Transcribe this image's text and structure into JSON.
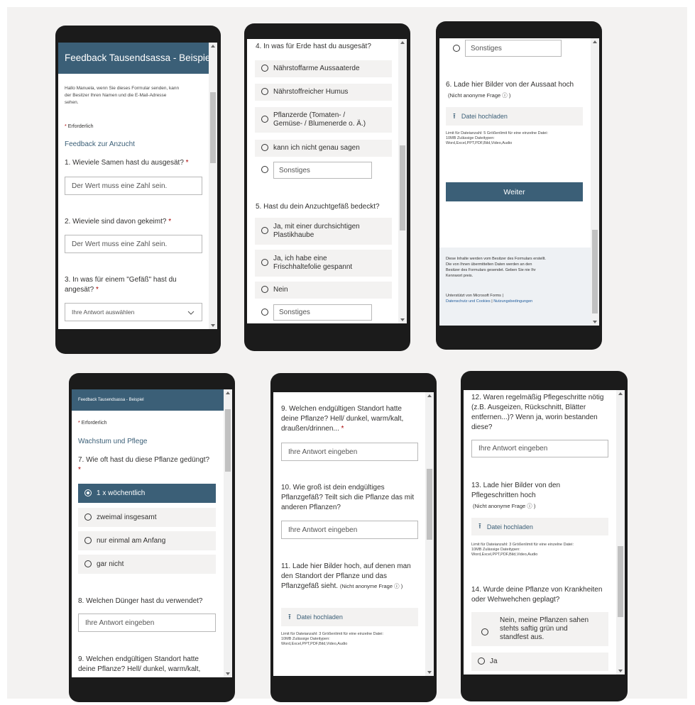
{
  "p1": {
    "title": "Feedback Tausendsassa - Beispiel",
    "greeting_1": "Hallo Manuela, wenn Sie dieses Formular senden, kann",
    "greeting_2": "der Besitzer Ihren Namen und die E-Mail-Adresse",
    "greeting_3": "sehen.",
    "required_note": "Erforderlich",
    "section": "Feedback zur Anzucht",
    "q1": "1. Wieviele Samen hast du ausgesät?",
    "q1_placeholder": "Der Wert muss eine Zahl sein.",
    "q2": "2. Wieviele sind davon gekeimt?",
    "q2_placeholder": "Der Wert muss eine Zahl sein.",
    "q3_line1": "3. In was für einem \"Gefäß\" hast du",
    "q3_line2": "angesät?",
    "q3_select": "Ihre Antwort auswählen"
  },
  "p2": {
    "q4": "4. In was für Erde hast du ausgesät?",
    "opt1": "Nährstoffarme Aussaaterde",
    "opt2": "Nährstoffreicher Humus",
    "opt3_line1": "Pflanzerde (Tomaten- /",
    "opt3_line2": "Gemüse- / Blumenerde o. Ä.)",
    "opt4": "kann ich nicht genau sagen",
    "opt5": "Sonstiges",
    "q5": "5. Hast du dein Anzuchtgefäß bedeckt?",
    "q5_opt1_line1": "Ja, mit einer durchsichtigen",
    "q5_opt1_line2": "Plastikhaube",
    "q5_opt2_line1": "Ja, ich habe eine",
    "q5_opt2_line2": "Frischhaltefolie gespannt",
    "q5_opt3": "Nein",
    "q5_opt4": "Sonstiges"
  },
  "p3": {
    "sonstiges": "Sonstiges",
    "q6": "6. Lade hier Bilder von der Aussaat hoch",
    "q6_note": "(Nicht anonyme Frage ⓘ )",
    "upload": "Datei hochladen",
    "limit_1": "Limit für Dateianzahl: 5   Größenlimit für eine einzelne Datei:",
    "limit_2": "10MB   Zulässige Dateitypen:",
    "limit_3": "Word,Excel,PPT,PDF,Bild,Video,Audio",
    "next_button": "Weiter",
    "footer_1": "Diese Inhalte werden vom Besitzer des Formulars erstellt.",
    "footer_2": "Die von Ihnen übermittelten Daten werden an den",
    "footer_3": "Besitzer des Formulars gesendet. Geben Sie nie Ihr",
    "footer_4": "Kennwort preis.",
    "powered": "Unterstützt von Microsoft Forms |",
    "privacy_link": "Datenschutz und Cookies",
    "sep": " | ",
    "terms_link": "Nutzungsbedingungen"
  },
  "p4": {
    "title": "Feedback Tausendsassa - Beispiel",
    "required_note": "Erforderlich",
    "section": "Wachstum und Pflege",
    "q7": "7. Wie oft hast du diese Pflanze gedüngt?",
    "opt1": "1 x wöchentlich",
    "opt2": "zweimal insgesamt",
    "opt3": "nur einmal am Anfang",
    "opt4": "gar nicht",
    "q8": "8. Welchen Dünger hast du verwendet?",
    "q8_placeholder": "Ihre Antwort eingeben",
    "q9_line1": "9. Welchen endgültigen Standort hatte",
    "q9_line2": "deine Pflanze? Hell/ dunkel, warm/kalt,"
  },
  "p5": {
    "q9_line1": "9. Welchen endgültigen Standort hatte",
    "q9_line2": "deine Pflanze? Hell/ dunkel, warm/kalt,",
    "q9_line3": "draußen/drinnen...",
    "q9_placeholder": "Ihre Antwort eingeben",
    "q10_line1": "10. Wie groß ist dein endgültiges",
    "q10_line2": "Pflanzgefäß? Teilt sich die Pflanze das mit",
    "q10_line3": "anderen Pflanzen?",
    "q10_placeholder": "Ihre Antwort eingeben",
    "q11_line1": "11. Lade hier Bilder hoch, auf denen man",
    "q11_line2": "den Standort der Pflanze und das",
    "q11_line3": "Pflanzgefäß sieht.",
    "q11_note": "(Nicht anonyme Frage ⓘ )",
    "upload": "Datei hochladen",
    "limit_1": "Limit für Dateianzahl: 3   Größenlimit für eine einzelne Datei:",
    "limit_2": "10MB   Zulässige Dateitypen:",
    "limit_3": "Word,Excel,PPT,PDF,Bild,Video,Audio"
  },
  "p6": {
    "q12_line1": "12. Waren regelmäßig Pflegeschritte nötig",
    "q12_line2": "(z.B. Ausgeizen, Rückschnitt, Blätter",
    "q12_line3": "entfernen...)? Wenn ja, worin bestanden",
    "q12_line4": "diese?",
    "q12_placeholder": "Ihre Antwort eingeben",
    "q13_line1": "13. Lade hier Bilder von den",
    "q13_line2": "Pflegeschritten hoch",
    "q13_note": "(Nicht anonyme Frage ⓘ )",
    "upload": "Datei hochladen",
    "limit_1": "Limit für Dateianzahl: 3   Größenlimit für eine einzelne Datei:",
    "limit_2": "10MB   Zulässige Dateitypen:",
    "limit_3": "Word,Excel,PPT,PDF,Bild,Video,Audio",
    "q14_line1": "14. Wurde deine Pflanze von Krankheiten",
    "q14_line2": "oder Wehwehchen geplagt?",
    "q14_opt1_line1": "Nein, meine Pflanzen sahen",
    "q14_opt1_line2": "stehts saftig grün und",
    "q14_opt1_line3": "standfest aus.",
    "q14_opt2": "Ja"
  },
  "colors": {
    "accent": "#3b5f77",
    "required": "#a80000",
    "option_bg": "#f3f2f1"
  }
}
